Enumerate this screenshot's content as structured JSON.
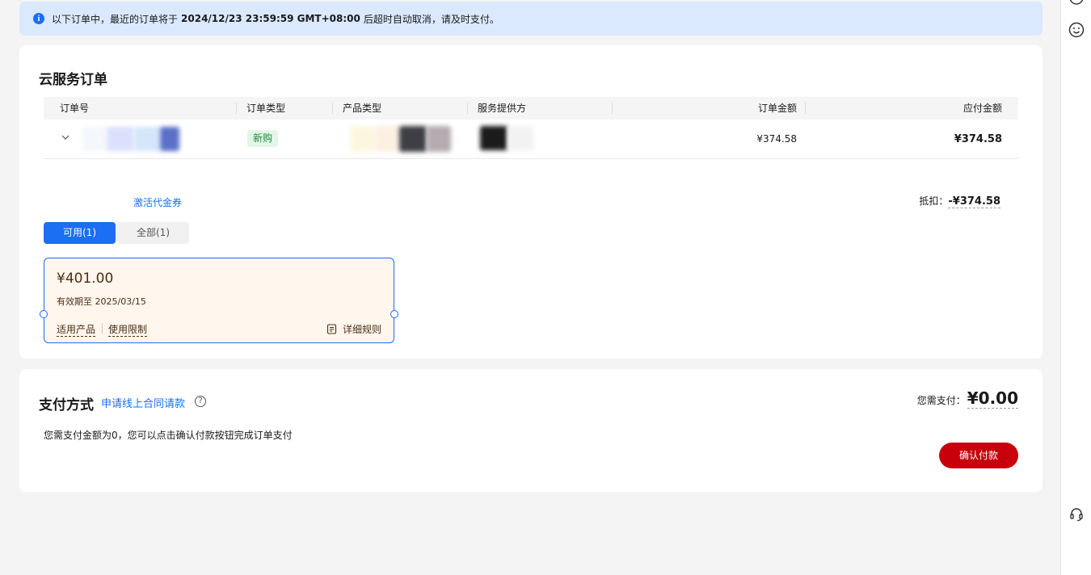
{
  "notice": {
    "prefix": "以下订单中，最近的订单将于",
    "deadline": "2024/12/23 23:59:59 GMT+08:00",
    "suffix": "后超时自动取消，请及时支付。"
  },
  "orders": {
    "title": "云服务订单",
    "columns": {
      "order_no": "订单号",
      "order_type": "订单类型",
      "product_type": "产品类型",
      "provider": "服务提供方",
      "order_amount": "订单金额",
      "payable": "应付金额"
    },
    "row": {
      "order_type": "新购",
      "order_amount": "¥374.58",
      "payable": "¥374.58"
    }
  },
  "voucher": {
    "activate_label": "激活代金券",
    "deduct_label": "抵扣：",
    "deduct_value": "-¥374.58",
    "tabs": {
      "available": "可用(1)",
      "all": "全部(1)"
    },
    "card": {
      "amount": "¥401.00",
      "validity": "有效期至 2025/03/15",
      "products_link": "适用产品",
      "limits_link": "使用限制",
      "rules_link": "详细规则"
    }
  },
  "payment": {
    "title": "支付方式",
    "apply_link": "申请线上合同请款",
    "need_pay_label": "您需支付：",
    "need_pay_value": "¥0.00",
    "note": "您需支付金额为0，您可以点击确认付款按钮完成订单支付",
    "confirm_label": "确认付款"
  },
  "colors": {
    "accent": "#1a6ff2",
    "confirm": "#c7000b",
    "notice_bg": "#dbe9fe",
    "voucher_bg": "#fff6ee"
  },
  "icons": [
    "info-icon",
    "chevron-down-icon",
    "document-icon",
    "help-icon",
    "smiley-icon",
    "headset-icon"
  ]
}
